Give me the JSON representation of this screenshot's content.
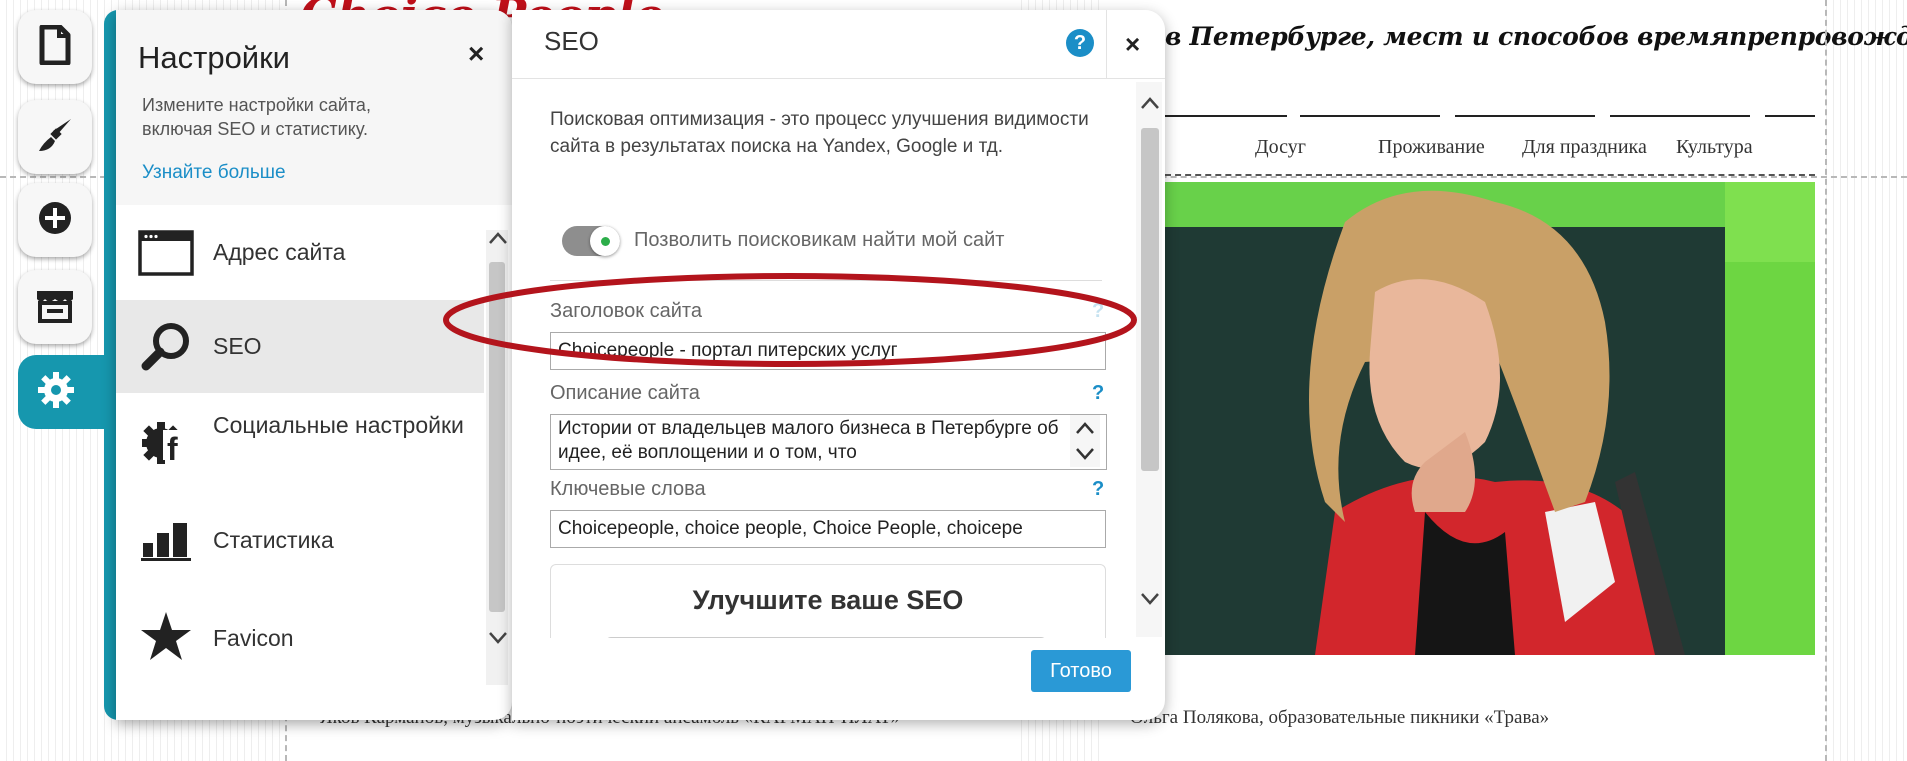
{
  "site": {
    "logo_text": "Choice People",
    "tagline": "в Петербурге, мест и способов времяпрепровождения.",
    "nav": [
      "Досуг",
      "Проживание",
      "Для праздника",
      "Культура"
    ],
    "caption_left": "Яков Карманов, музыкально-поэтический ансамбль «КАРМАН-ПЛАТ»",
    "caption_right": "Ольга Полякова, образовательные пикники «Трава»"
  },
  "toolbar": {
    "items": [
      {
        "icon": "page-icon"
      },
      {
        "icon": "brush-icon"
      },
      {
        "icon": "plus-circle-icon"
      },
      {
        "icon": "store-icon"
      },
      {
        "icon": "gear-icon",
        "active": true
      }
    ]
  },
  "settings": {
    "title": "Настройки",
    "close": "×",
    "description": "Измените настройки сайта, включая SEO и статистику.",
    "learn_more": "Узнайте больше",
    "menu": [
      {
        "label": "Адрес сайта",
        "icon": "browser-window-icon"
      },
      {
        "label": "SEO",
        "icon": "magnifier-icon",
        "active": true
      },
      {
        "label": "Социальные настройки",
        "icon": "social-gear-icon"
      },
      {
        "label": "Статистика",
        "icon": "bar-chart-icon"
      },
      {
        "label": "Favicon",
        "icon": "star-icon"
      }
    ],
    "scroll_up": "⌃",
    "scroll_down": "⌄"
  },
  "seo": {
    "title": "SEO",
    "help": "?",
    "close": "×",
    "intro": "Поисковая оптимизация - это процесс улучшения видимости сайта в результатах поиска на Yandex, Google и тд.",
    "toggle_label": "Позволить поисковикам найти мой сайт",
    "toggle_on": true,
    "site_title_label": "Заголовок сайта",
    "site_title_value": "Choicepeople - портал питерских услуг",
    "description_label": "Описание сайта",
    "description_value": "Истории от владельцев малого бизнеса в Петербурге об идее, её воплощении и о том, что",
    "keywords_label": "Ключевые слова",
    "keywords_value": "Choicepeople, choice people, Choice People, choicepe",
    "help_mark": "?",
    "improve_title": "Улучшите ваше SEO",
    "done": "Готово"
  },
  "colors": {
    "accent": "#1697ae",
    "link": "#1b8ec7",
    "button": "#2a99d6",
    "annotation": "#b3141c"
  }
}
